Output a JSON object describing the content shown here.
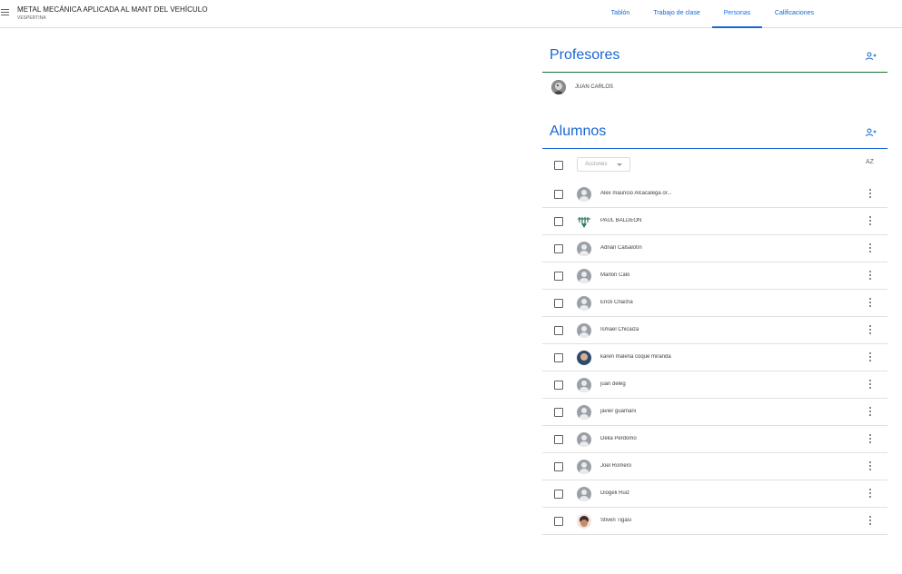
{
  "header": {
    "class_title": "METAL MECÁNICA APLICADA AL MANT DEL VEHÍCULO",
    "class_section": "VESPERTINA",
    "tabs": [
      {
        "label": "Tablón",
        "active": false
      },
      {
        "label": "Trabajo de clase",
        "active": false
      },
      {
        "label": "Personas",
        "active": true
      },
      {
        "label": "Calificaciones",
        "active": false
      }
    ],
    "accent_color": "#1967d2"
  },
  "teachers": {
    "title": "Profesores",
    "line_color": "#137333",
    "list": [
      {
        "name": "JUAN CARLOS",
        "avatar": "photo"
      }
    ]
  },
  "students": {
    "title": "Alumnos",
    "line_color": "#1967d2",
    "actions_label": "Acciones",
    "list": [
      {
        "name": "Alex mauricio Alcacalega or...",
        "avatar": "default"
      },
      {
        "name": "PAÚL BALDEÓN",
        "avatar": "logo"
      },
      {
        "name": "Adrian Calsalotín",
        "avatar": "default"
      },
      {
        "name": "Marlon Calo",
        "avatar": "default"
      },
      {
        "name": "Erick Chacha",
        "avatar": "default"
      },
      {
        "name": "Ismael Chicaiza",
        "avatar": "default"
      },
      {
        "name": "karen malena coque miranda",
        "avatar": "photo1"
      },
      {
        "name": "juan deleg",
        "avatar": "default"
      },
      {
        "name": "javier guamani",
        "avatar": "default"
      },
      {
        "name": "Delia Perdomo",
        "avatar": "default"
      },
      {
        "name": "Joel Romero",
        "avatar": "default"
      },
      {
        "name": "Diogeli Ruiz",
        "avatar": "default"
      },
      {
        "name": "Stiven Tigasi",
        "avatar": "photo2"
      }
    ]
  },
  "icons": {
    "menu": "hamburger-menu-icon",
    "add_teacher": "add-person-icon",
    "add_student": "add-person-icon",
    "sort": "sort-az-icon",
    "more": "more-vertical-icon",
    "sort_glyph": "AZ"
  }
}
